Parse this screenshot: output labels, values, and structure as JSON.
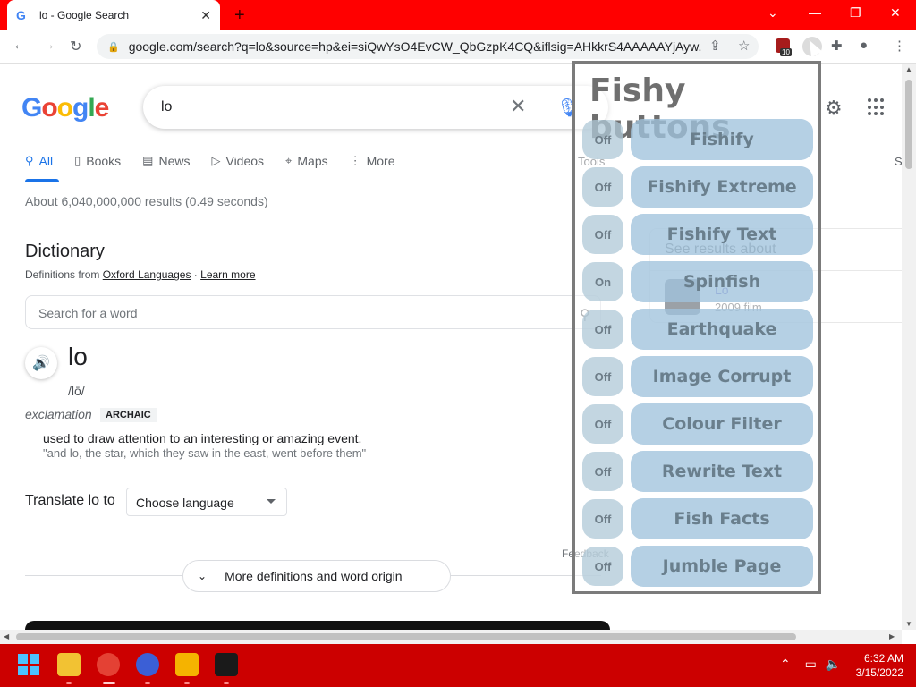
{
  "browser": {
    "tab_title": "lo - Google Search",
    "url": "google.com/search?q=lo&source=hp&ei=siQwYsO4EvCW_QbGzpK4CQ&iflsig=AHkkrS4AAAAAYjAyw...",
    "extension_badge_count": "10"
  },
  "search": {
    "logo": "Google",
    "query": "lo",
    "tabs": [
      {
        "label": "All"
      },
      {
        "label": "Books"
      },
      {
        "label": "News"
      },
      {
        "label": "Videos"
      },
      {
        "label": "Maps"
      },
      {
        "label": "More"
      }
    ],
    "tools_label": "Tools",
    "stats": "About 6,040,000,000 results (0.49 seconds)"
  },
  "dictionary": {
    "title": "Dictionary",
    "source_prefix": "Definitions from",
    "source_link": "Oxford Languages",
    "learn_more": "Learn more",
    "search_placeholder": "Search for a word",
    "word": "lo",
    "phonetic": "/lō/",
    "part_of_speech": "exclamation",
    "tag": "ARCHAIC",
    "definition": "used to draw attention to an interesting or amazing event.",
    "example": "\"and lo, the star, which they saw in the east, went before them\"",
    "translate_label": "Translate lo to",
    "language_select": "Choose language",
    "feedback": "Feedback",
    "more_button": "More definitions and word origin"
  },
  "knowledge_panel": {
    "header": "See results about",
    "name": "Lo",
    "subtitle": "2009 film"
  },
  "fishy": {
    "title": "Fishy buttons",
    "rows": [
      {
        "state": "Off",
        "label": "Fishify"
      },
      {
        "state": "Off",
        "label": "Fishify Extreme"
      },
      {
        "state": "Off",
        "label": "Fishify Text"
      },
      {
        "state": "On",
        "label": "Spinfish"
      },
      {
        "state": "Off",
        "label": "Earthquake"
      },
      {
        "state": "Off",
        "label": "Image Corrupt"
      },
      {
        "state": "Off",
        "label": "Colour Filter"
      },
      {
        "state": "Off",
        "label": "Rewrite Text"
      },
      {
        "state": "Off",
        "label": "Fish Facts"
      },
      {
        "state": "Off",
        "label": "Jumble Page"
      }
    ]
  },
  "taskbar": {
    "time": "6:32 AM",
    "date": "3/15/2022"
  }
}
